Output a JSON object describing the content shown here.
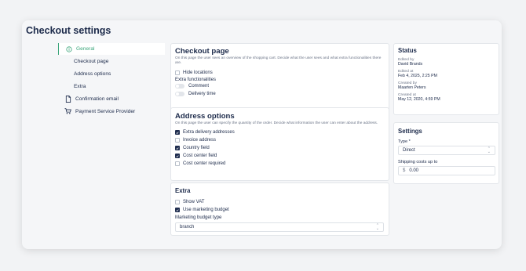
{
  "page": {
    "title": "Checkout settings"
  },
  "nav": {
    "general": "General",
    "checkout_page": "Checkout page",
    "address_options": "Address options",
    "extra": "Extra",
    "confirmation_email": "Confirmation email",
    "payment_provider": "Payment Service Provider"
  },
  "checkout": {
    "title": "Checkout page",
    "description": "On this page the user sees an overview of the shopping cart. Decide what the user sees and what extra functionalities there are.",
    "hide_locations": "Hide locations",
    "extra_functionalities": "Extra functionalities",
    "comment": "Comment",
    "delivery_time": "Delivery time"
  },
  "address": {
    "title": "Address options",
    "description": "On this page the user can specify the quantity of the order. Decide what information the user can enter about the address.",
    "options": [
      {
        "label": "Extra delivery addresses",
        "checked": true
      },
      {
        "label": "Invoice address",
        "checked": false
      },
      {
        "label": "Country field",
        "checked": true
      },
      {
        "label": "Cost center field",
        "checked": true
      },
      {
        "label": "Cost center required",
        "checked": false
      }
    ]
  },
  "extra": {
    "title": "Extra",
    "show_vat": "Show VAT",
    "use_marketing_budget": "Use marketing budget",
    "budget_type_label": "Marketing budget type",
    "budget_type_value": "branch"
  },
  "status": {
    "title": "Status",
    "edited_by_label": "Edited by",
    "edited_by": "David Brands",
    "edited_at_label": "Edited at",
    "edited_at": "Feb 4, 2025, 2:25 PM",
    "created_by_label": "Created by",
    "created_by": "Maarten Peters",
    "created_at_label": "Created at",
    "created_at": "May 12, 2020, 4:59 PM"
  },
  "settings": {
    "title": "Settings",
    "type_label": "Type *",
    "type_value": "Direct",
    "shipping_label": "Shipping costs up to",
    "currency": "$",
    "shipping_value": "0.00"
  },
  "colors": {
    "accent": "#3aa57a",
    "navy": "#1f2d4f"
  }
}
